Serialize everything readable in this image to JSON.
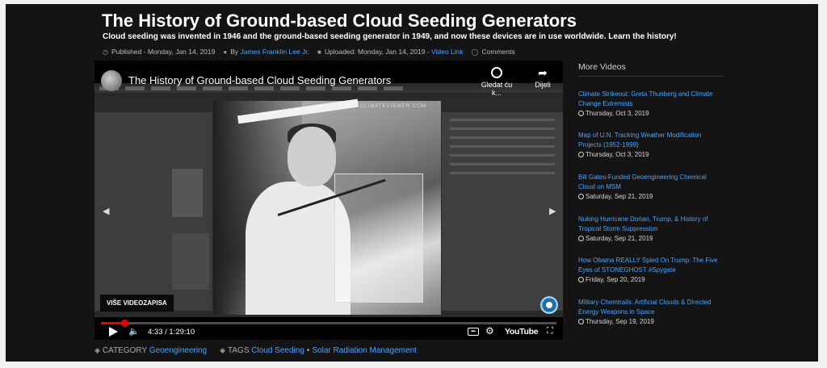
{
  "article": {
    "title": "The History of Ground-based Cloud Seeding Generators",
    "subtitle": "Cloud seeding was invented in 1946 and the ground-based seeding generator in 1949, and now these devices are in use worldwide. Learn the history!",
    "published_label": "Published - Monday, Jan 14, 2019",
    "by_label": "By",
    "author": "James Franklin Lee Jr.",
    "uploaded_label": "Uploaded: Monday, Jan 14, 2019 -",
    "video_link": "Video Link",
    "comments": "Comments"
  },
  "video": {
    "title": "The History of Ground-based Cloud Seeding Generators",
    "watch_later": "Gledat ću k...",
    "share": "Dijeli",
    "more_videos": "VIŠE VIDEOZAPISA",
    "time": "4:33 / 1:29:10",
    "progress_fraction": 0.051,
    "watermark_site": "CLIMATEVIEWER.COM",
    "brand": "YouTube"
  },
  "footer": {
    "category_label": "CATEGORY",
    "category": "Geoengineering",
    "tags_label": "TAGS",
    "tags": [
      "Cloud Seeding",
      "Solar Radiation Management"
    ],
    "tag_separator": "•"
  },
  "sidebar": {
    "heading": "More Videos",
    "items": [
      {
        "title": "Climate Strikeout: Greta Thunberg and Climate Change Extremists",
        "date": "Thursday, Oct 3, 2019"
      },
      {
        "title": "Map of U.N. Tracking Weather Modification Projects (1952-1999)",
        "date": "Thursday, Oct 3, 2019"
      },
      {
        "title": "Bill Gates-Funded Geoengineering Chemical Cloud on MSM",
        "date": "Saturday, Sep 21, 2019"
      },
      {
        "title": "Nuking Hurricane Dorian, Trump, & History of Tropical Storm Suppression",
        "date": "Saturday, Sep 21, 2019"
      },
      {
        "title": "How Obama REALLY Spied On Trump: The Five Eyes of STONEGHOST #Spygate",
        "date": "Friday, Sep 20, 2019"
      },
      {
        "title": "Military Chemtrails: Artificial Clouds & Directed Energy Weapons in Space",
        "date": "Thursday, Sep 19, 2019"
      }
    ]
  }
}
